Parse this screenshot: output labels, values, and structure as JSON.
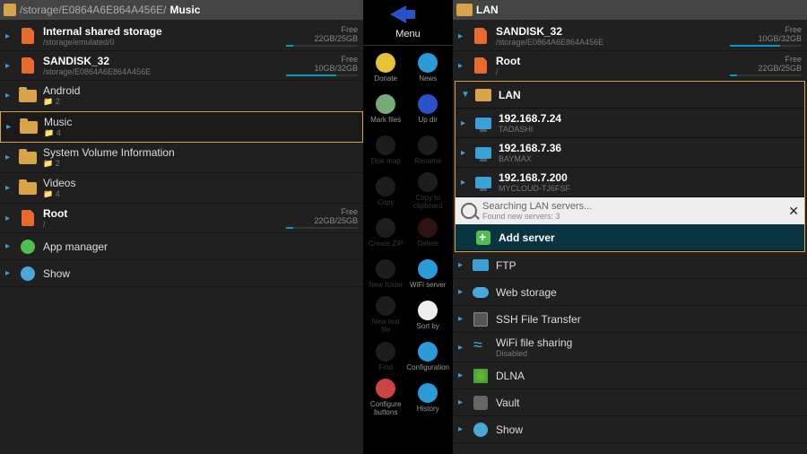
{
  "left": {
    "path_prefix": "/storage/E0864A6E864A456E/",
    "path_last": "Music",
    "items": [
      {
        "icon": "sd",
        "title": "Internal shared storage",
        "sub": "/storage/emulated/0",
        "free": "Free",
        "size": "22GB/25GB",
        "bar": 10
      },
      {
        "icon": "sd",
        "title": "SANDISK_32",
        "sub": "/storage/E0864A6E864A456E",
        "free": "Free",
        "size": "10GB/32GB",
        "bar": 70
      },
      {
        "icon": "folder",
        "title": "Android",
        "sub": "📁 2"
      },
      {
        "icon": "folder",
        "title": "Music",
        "sub": "📁 4",
        "selected": true
      },
      {
        "icon": "folder",
        "title": "System Volume Information",
        "sub": "📁 2"
      },
      {
        "icon": "folder",
        "title": "Videos",
        "sub": "📁 4"
      },
      {
        "icon": "sd",
        "title": "Root",
        "sub": "/",
        "free": "Free",
        "size": "22GB/25GB",
        "bar": 10
      },
      {
        "icon": "app",
        "title": "App manager"
      },
      {
        "icon": "gear",
        "title": "Show"
      }
    ]
  },
  "right": {
    "path_icon": "net",
    "path_last": "LAN",
    "top": [
      {
        "icon": "sd",
        "title": "SANDISK_32",
        "sub": "/storage/E0864A6E864A456E",
        "free": "Free",
        "size": "10GB/32GB",
        "bar": 70
      },
      {
        "icon": "sd",
        "title": "Root",
        "sub": "/",
        "free": "Free",
        "size": "22GB/25GB",
        "bar": 10
      }
    ],
    "lan": {
      "header": "LAN",
      "hosts": [
        {
          "ip": "192.168.7.24",
          "name": "TADASHI"
        },
        {
          "ip": "192.168.7.36",
          "name": "BAYMAX"
        },
        {
          "ip": "192.168.7.200",
          "name": "MYCLOUD-TJ6FSF"
        }
      ],
      "search": {
        "line1": "Searching LAN servers...",
        "line2": "Found new servers: 3"
      },
      "add": "Add server"
    },
    "services": [
      {
        "icon": "ftp",
        "title": "FTP"
      },
      {
        "icon": "cloud",
        "title": "Web storage"
      },
      {
        "icon": "ssh",
        "title": "SSH File Transfer"
      },
      {
        "icon": "wifi",
        "title": "WiFi file sharing",
        "sub": "Disabled"
      },
      {
        "icon": "dlna",
        "title": "DLNA"
      },
      {
        "icon": "vault",
        "title": "Vault"
      },
      {
        "icon": "gear",
        "title": "Show"
      }
    ]
  },
  "toolbar": {
    "menu": "Menu",
    "items": [
      {
        "label": "Donate",
        "dis": false,
        "color": "#e6c13a"
      },
      {
        "label": "News",
        "dis": false,
        "color": "#2a9ad8"
      },
      {
        "label": "Mark files",
        "dis": false,
        "color": "#7a7"
      },
      {
        "label": "Up dir",
        "dis": false,
        "color": "#2951c8"
      },
      {
        "label": "Disk map",
        "dis": true,
        "color": "#555"
      },
      {
        "label": "Rename",
        "dis": true,
        "color": "#555"
      },
      {
        "label": "Copy",
        "dis": true,
        "color": "#555"
      },
      {
        "label": "Copy to clipboard",
        "dis": true,
        "color": "#555"
      },
      {
        "label": "Create ZIP",
        "dis": true,
        "color": "#555"
      },
      {
        "label": "Delete",
        "dis": true,
        "color": "#833"
      },
      {
        "label": "New folder",
        "dis": true,
        "color": "#555"
      },
      {
        "label": "WiFi server",
        "dis": false,
        "color": "#2a9ad8"
      },
      {
        "label": "New text file",
        "dis": true,
        "color": "#555"
      },
      {
        "label": "Sort by",
        "dis": false,
        "color": "#eee"
      },
      {
        "label": "Find",
        "dis": true,
        "color": "#555"
      },
      {
        "label": "Configuration",
        "dis": false,
        "color": "#2a9ad8"
      },
      {
        "label": "Configure buttons",
        "dis": false,
        "color": "#c44"
      },
      {
        "label": "History",
        "dis": false,
        "color": "#2a9ad8"
      }
    ]
  }
}
